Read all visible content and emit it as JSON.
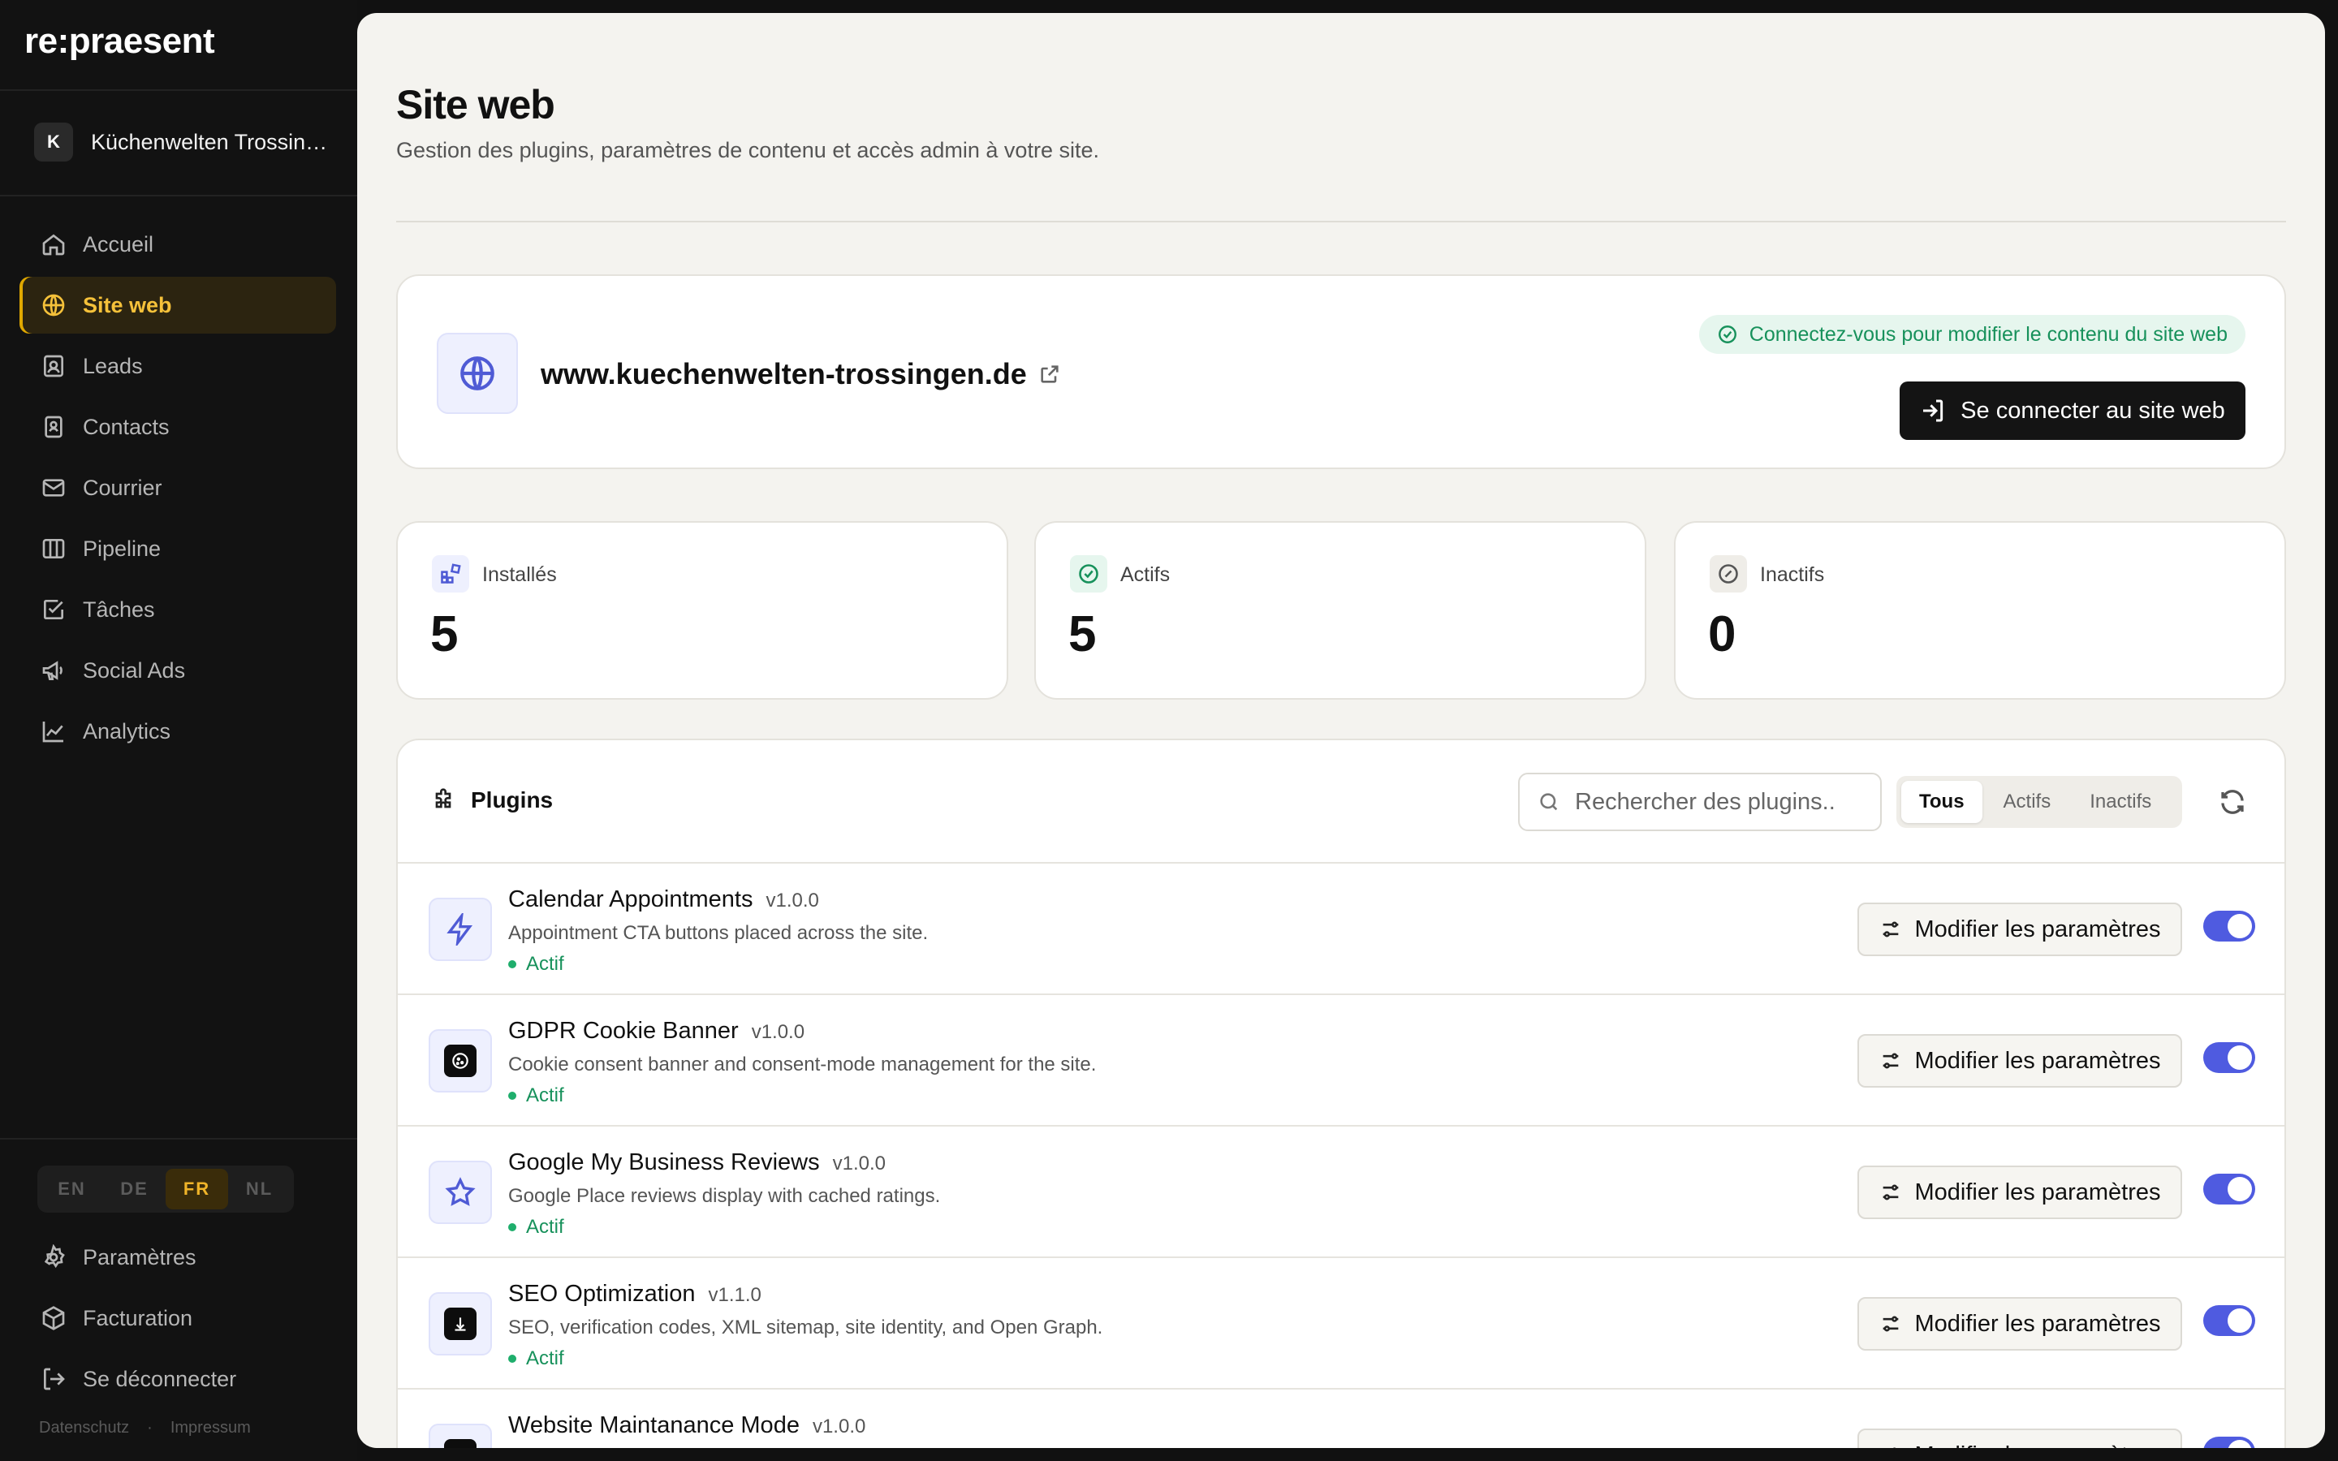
{
  "app": {
    "logo": "re:praesent"
  },
  "workspace": {
    "avatar_letter": "K",
    "name": "Küchenwelten Trossingen"
  },
  "sidebar": {
    "items": [
      {
        "label": "Accueil",
        "icon": "home-icon"
      },
      {
        "label": "Site web",
        "icon": "globe-icon",
        "active": true
      },
      {
        "label": "Leads",
        "icon": "contact-card-icon"
      },
      {
        "label": "Contacts",
        "icon": "contacts-book-icon"
      },
      {
        "label": "Courrier",
        "icon": "mail-icon"
      },
      {
        "label": "Pipeline",
        "icon": "columns-icon"
      },
      {
        "label": "Tâches",
        "icon": "check-square-icon"
      },
      {
        "label": "Social Ads",
        "icon": "megaphone-icon"
      },
      {
        "label": "Analytics",
        "icon": "line-chart-icon"
      }
    ],
    "languages": [
      "EN",
      "DE",
      "FR",
      "NL"
    ],
    "active_language": "FR",
    "settings_label": "Paramètres",
    "billing_label": "Facturation",
    "logout_label": "Se déconnecter",
    "legal": {
      "privacy": "Datenschutz",
      "separator": "·",
      "imprint": "Impressum"
    }
  },
  "page": {
    "title": "Site web",
    "subtitle": "Gestion des plugins, paramètres de contenu et accès admin à votre site."
  },
  "site": {
    "url": "www.kuechenwelten-trossingen.de",
    "hint": "Connectez-vous pour modifier le contenu du site web",
    "connect_label": "Se connecter au site web"
  },
  "stats": {
    "installed": {
      "label": "Installés",
      "value": "5"
    },
    "active": {
      "label": "Actifs",
      "value": "5"
    },
    "inactive": {
      "label": "Inactifs",
      "value": "0"
    }
  },
  "plugins": {
    "title": "Plugins",
    "search_placeholder": "Rechercher des plugins..",
    "filters": [
      "Tous",
      "Actifs",
      "Inactifs"
    ],
    "active_filter": "Tous",
    "settings_label": "Modifier les paramètres",
    "items": [
      {
        "name": "Calendar Appointments",
        "version": "v1.0.0",
        "description": "Appointment CTA buttons placed across the site.",
        "status": "Actif",
        "enabled": true,
        "icon": "lightning-icon"
      },
      {
        "name": "GDPR Cookie Banner",
        "version": "v1.0.0",
        "description": "Cookie consent banner and consent-mode management for the site.",
        "status": "Actif",
        "enabled": true,
        "icon": "cookie-icon"
      },
      {
        "name": "Google My Business Reviews",
        "version": "v1.0.0",
        "description": "Google Place reviews display with cached ratings.",
        "status": "Actif",
        "enabled": true,
        "icon": "star-icon"
      },
      {
        "name": "SEO Optimization",
        "version": "v1.1.0",
        "description": "SEO, verification codes, XML sitemap, site identity, and Open Graph.",
        "status": "Actif",
        "enabled": true,
        "icon": "seo-icon"
      },
      {
        "name": "Website Maintanance Mode",
        "version": "v1.0.0",
        "description": "",
        "status": "",
        "enabled": true,
        "icon": "maintenance-icon"
      }
    ]
  },
  "colors": {
    "accent": "#4f5be0",
    "active_nav": "#f5c13a",
    "success": "#17915b"
  }
}
